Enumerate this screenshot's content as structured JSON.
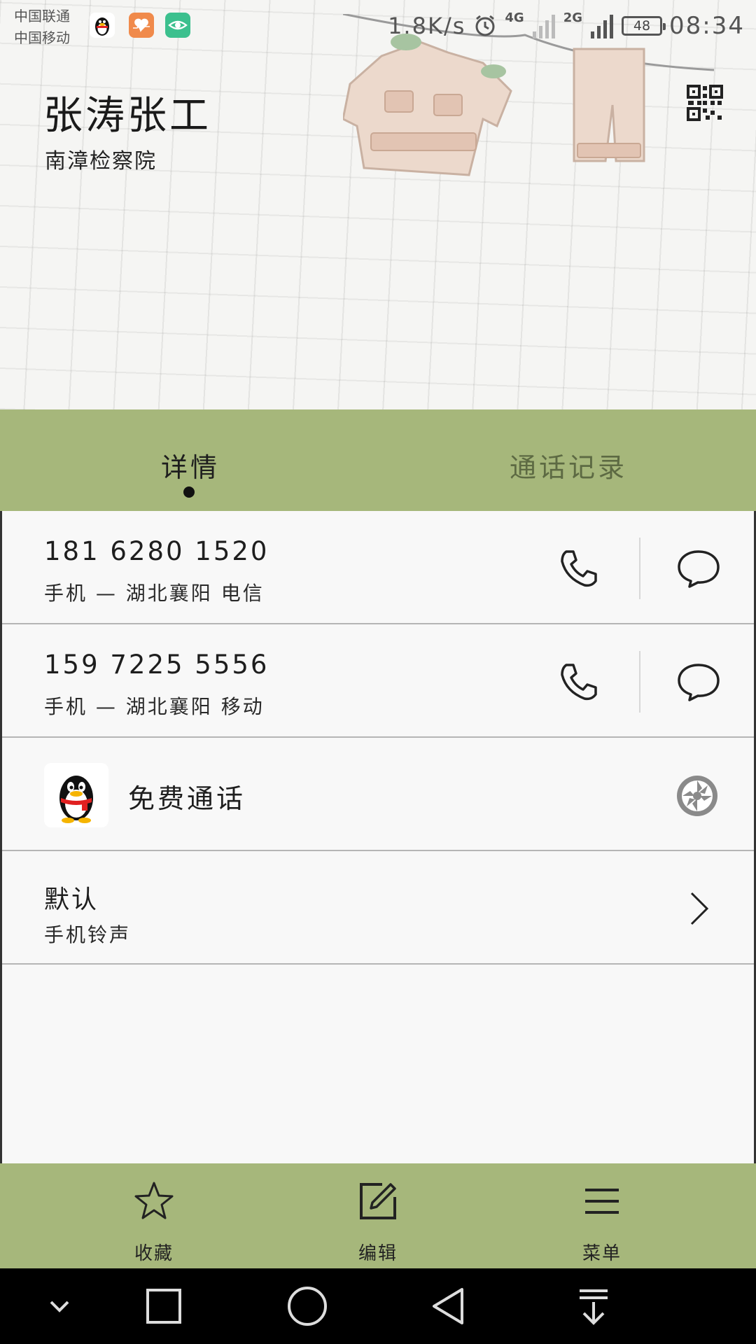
{
  "status_bar": {
    "carrier_1": "中国联通",
    "carrier_2": "中国移动",
    "app_icons": [
      "qq-icon",
      "health-icon",
      "eye-care-icon"
    ],
    "net_speed": "1.8K/s",
    "alarm_icon": "alarm-icon",
    "signal_1_label": "4G",
    "signal_2_label": "2G",
    "battery": "48",
    "time": "08:34"
  },
  "contact": {
    "name": "张涛张工",
    "organization": "南漳检察院",
    "qr_icon": "qr-code-icon"
  },
  "tabs": [
    {
      "label": "详情",
      "selected": true
    },
    {
      "label": "通话记录",
      "selected": false
    }
  ],
  "numbers": [
    {
      "number": "181 6280 1520",
      "description": "手机 — 湖北襄阳 电信",
      "call_icon": "phone-icon",
      "message_icon": "message-icon"
    },
    {
      "number": "159 7225 5556",
      "description": "手机 — 湖北襄阳 移动",
      "call_icon": "phone-icon",
      "message_icon": "message-icon"
    }
  ],
  "free_call": {
    "label": "免费通话",
    "app_icon": "qq-penguin-icon",
    "action_icon": "shutter-icon"
  },
  "ringtone": {
    "title": "默认",
    "subtitle": "手机铃声",
    "chevron": "chevron-right-icon"
  },
  "actions": [
    {
      "label": "收藏",
      "icon": "star-icon"
    },
    {
      "label": "编辑",
      "icon": "edit-icon"
    },
    {
      "label": "菜单",
      "icon": "menu-icon"
    }
  ],
  "navigation": [
    "chevron-down-icon",
    "recents-square-icon",
    "home-circle-icon",
    "back-triangle-icon",
    "notification-pull-icon"
  ],
  "colors": {
    "accent_green": "#a6b77b",
    "background": "#f8f8f8",
    "nav_bar": "#000000"
  }
}
